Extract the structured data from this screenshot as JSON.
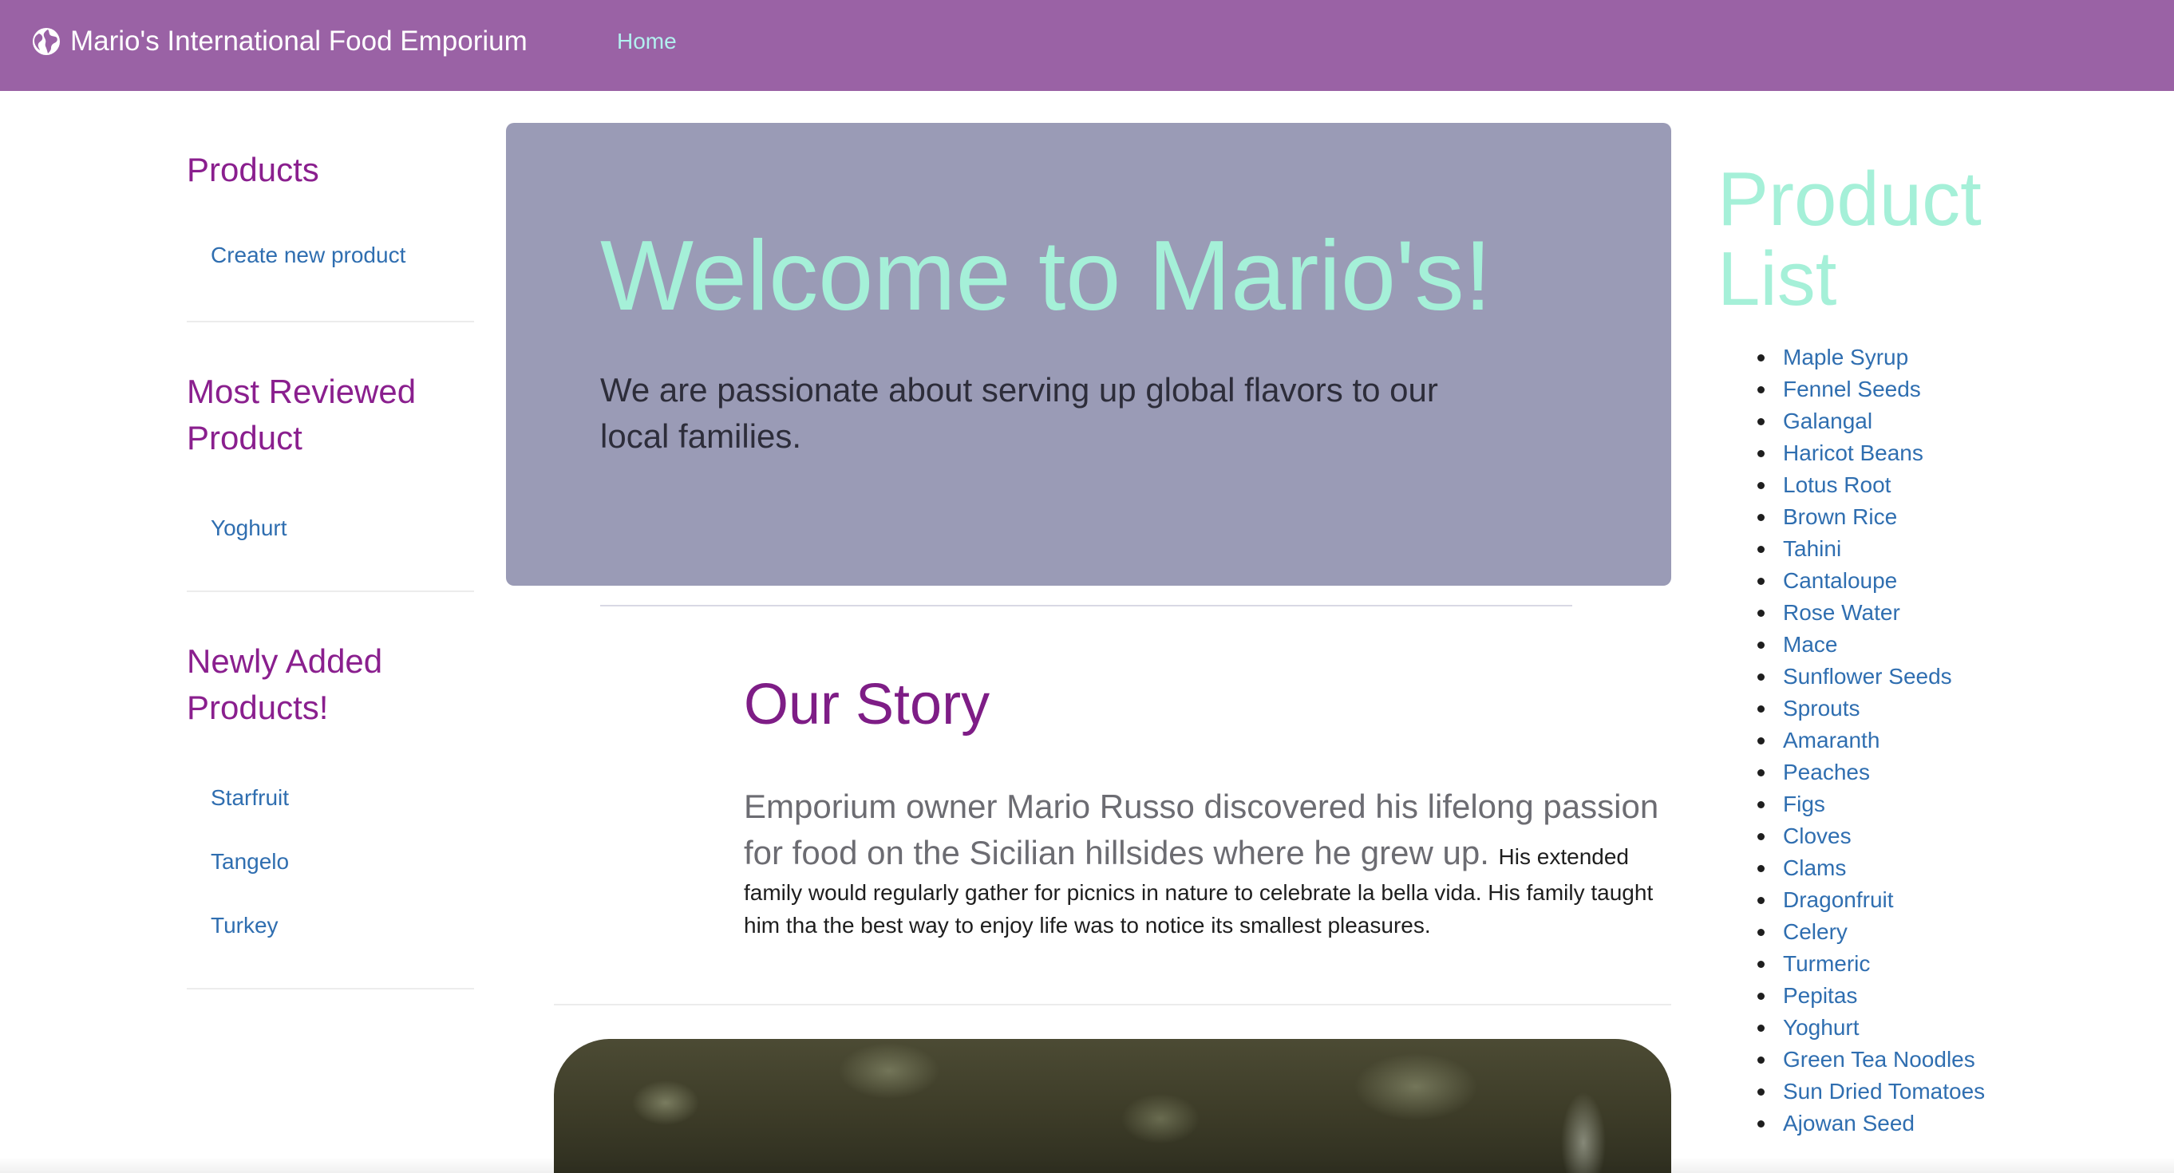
{
  "navbar": {
    "brand": "Mario's International Food Emporium",
    "brand_icon": "globe-icon",
    "home_label": "Home",
    "color": "#9a62a5"
  },
  "sidebar": {
    "sections": [
      {
        "heading": "Products",
        "links": [
          "Create new product"
        ]
      },
      {
        "heading": "Most Reviewed Product",
        "links": [
          "Yoghurt"
        ]
      },
      {
        "heading": "Newly Added Products!",
        "links": [
          "Starfruit",
          "Tangelo",
          "Turkey"
        ]
      }
    ]
  },
  "jumbotron": {
    "title": "Welcome to Mario's!",
    "subtitle": "We are passionate about serving up global flavors to our local families."
  },
  "story": {
    "title": "Our Story",
    "lead": "Emporium owner Mario Russo discovered his lifelong passion for food on the Sicilian hillsides where he grew up.",
    "body": "His extended family would regularly gather for picnics in nature to celebrate la bella vida. His family taught him tha the best way to enjoy life was to notice its smallest pleasures."
  },
  "product_list": {
    "title": "Product List",
    "items": [
      "Maple Syrup",
      "Fennel Seeds",
      "Galangal",
      "Haricot Beans",
      "Lotus Root",
      "Brown Rice",
      "Tahini",
      "Cantaloupe",
      "Rose Water",
      "Mace",
      "Sunflower Seeds",
      "Sprouts",
      "Amaranth",
      "Peaches",
      "Figs",
      "Cloves",
      "Clams",
      "Dragonfruit",
      "Celery",
      "Turmeric",
      "Pepitas",
      "Yoghurt",
      "Green Tea Noodles",
      "Sun Dried Tomatoes",
      "Ajowan Seed"
    ]
  }
}
